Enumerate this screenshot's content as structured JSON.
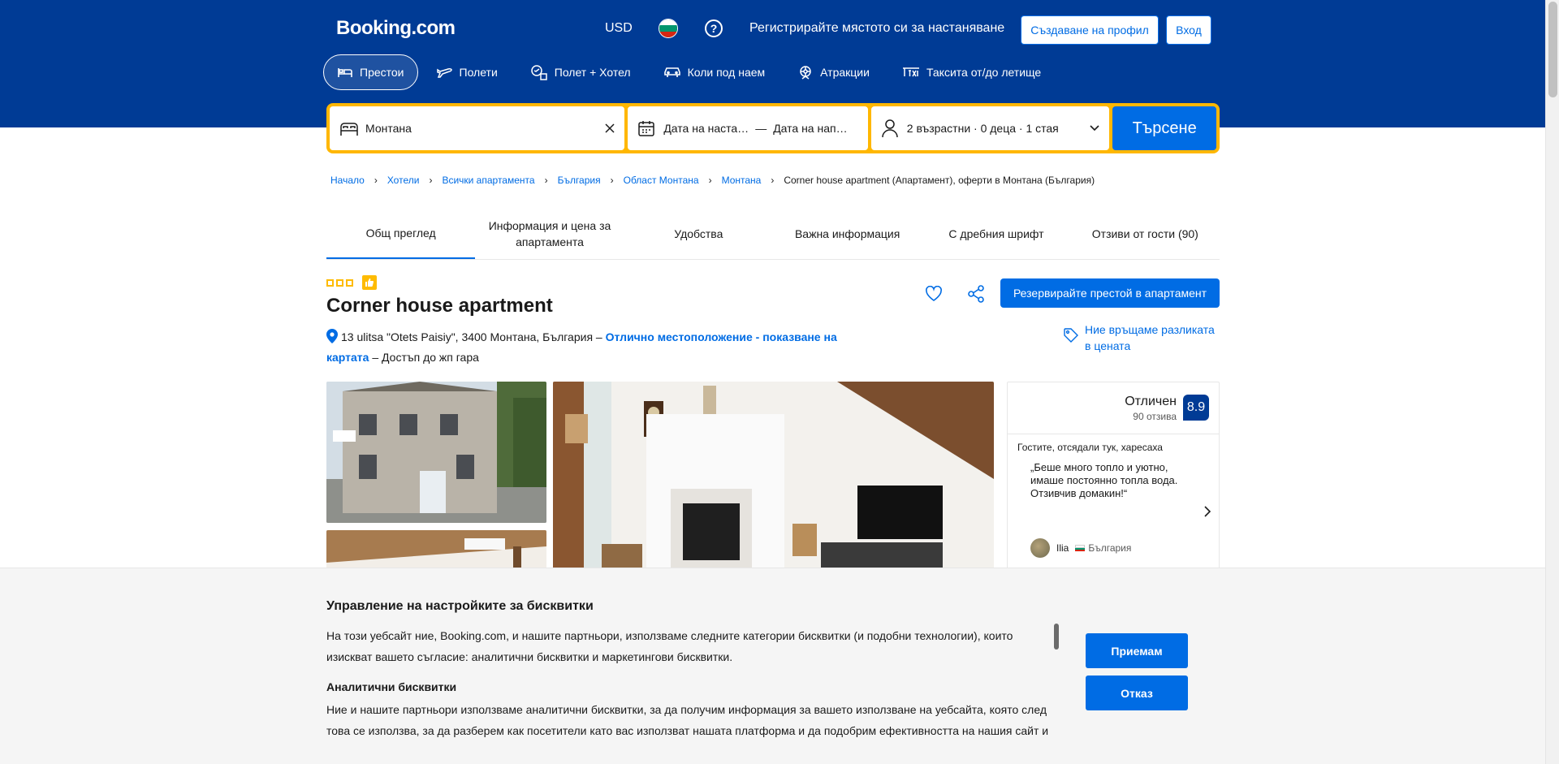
{
  "header": {
    "logo": "Booking.com",
    "currency": "USD",
    "register_text": "Регистрирайте мястото си за настаняване",
    "signup_label": "Създаване на профил",
    "signin_label": "Вход",
    "flag_colors": [
      "#ffffff",
      "#00966e",
      "#d62612"
    ]
  },
  "nav": {
    "tabs": [
      {
        "label": "Престои",
        "icon": "bed-icon"
      },
      {
        "label": "Полети",
        "icon": "plane-icon"
      },
      {
        "label": "Полет + Хотел",
        "icon": "flight-hotel-icon"
      },
      {
        "label": "Коли под наем",
        "icon": "car-icon"
      },
      {
        "label": "Атракции",
        "icon": "attractions-icon"
      },
      {
        "label": "Таксита от/до летище",
        "icon": "taxi-icon"
      }
    ]
  },
  "search": {
    "destination": "Монтана",
    "checkin": "Дата на наста…",
    "date_sep": "—",
    "checkout": "Дата на нап…",
    "guests": "2 възрастни · 0 деца · 1 стая",
    "button": "Търсене"
  },
  "breadcrumb": {
    "items": [
      "Начало",
      "Хотели",
      "Всички апартамента",
      "България",
      "Област Монтана",
      "Монтана"
    ],
    "current": "Corner house apartment (Апартамент), оферти в Монтана (България)"
  },
  "property_tabs": [
    "Общ преглед",
    "Информация и цена за апартамента",
    "Удобства",
    "Важна информация",
    "С дребния шрифт",
    "Отзиви от гости (90)"
  ],
  "property": {
    "stars": 3,
    "title": "Corner house apartment",
    "address": "13 ulitsa \"Otets Paisiy\", 3400 Монтана, България –",
    "location_link": "Отлично местоположение - показване на картата",
    "address_suffix": "– Достъп до жп гара",
    "reserve_label": "Резервирайте престой в апартамент",
    "price_match": "Ние връщаме разликата в цената"
  },
  "reviews": {
    "rating_word": "Отличен",
    "count": "90 отзива",
    "score": "8.9",
    "liked_title": "Гостите, отсядали тук, харесаха",
    "quote": "„Беше много топло и уютно, имаше постоянно топла вода. Отзивчив домакин!“",
    "reviewer": "Ilia",
    "country": "България"
  },
  "cookie": {
    "title": "Управление на настройките за бисквитки",
    "text": "На този уебсайт ние, Booking.com, и нашите партньори, използваме следните категории бисквитки (и подобни технологии), които изискват вашето съгласие: аналитични бисквитки и маркетингови бисквитки.",
    "subtitle": "Аналитични бисквитки",
    "text2": "Ние и нашите партньори използваме аналитични бисквитки, за да получим информация за вашето използване на уебсайта, която след това се използва, за да разберем как посетители като вас използват нашата платформа и да подобрим ефективността на нашия сайт и",
    "accept": "Приемам",
    "reject": "Отказ"
  },
  "colors": {
    "brand": "#003b95",
    "accent": "#006ce4",
    "search_border": "#ffb700"
  }
}
